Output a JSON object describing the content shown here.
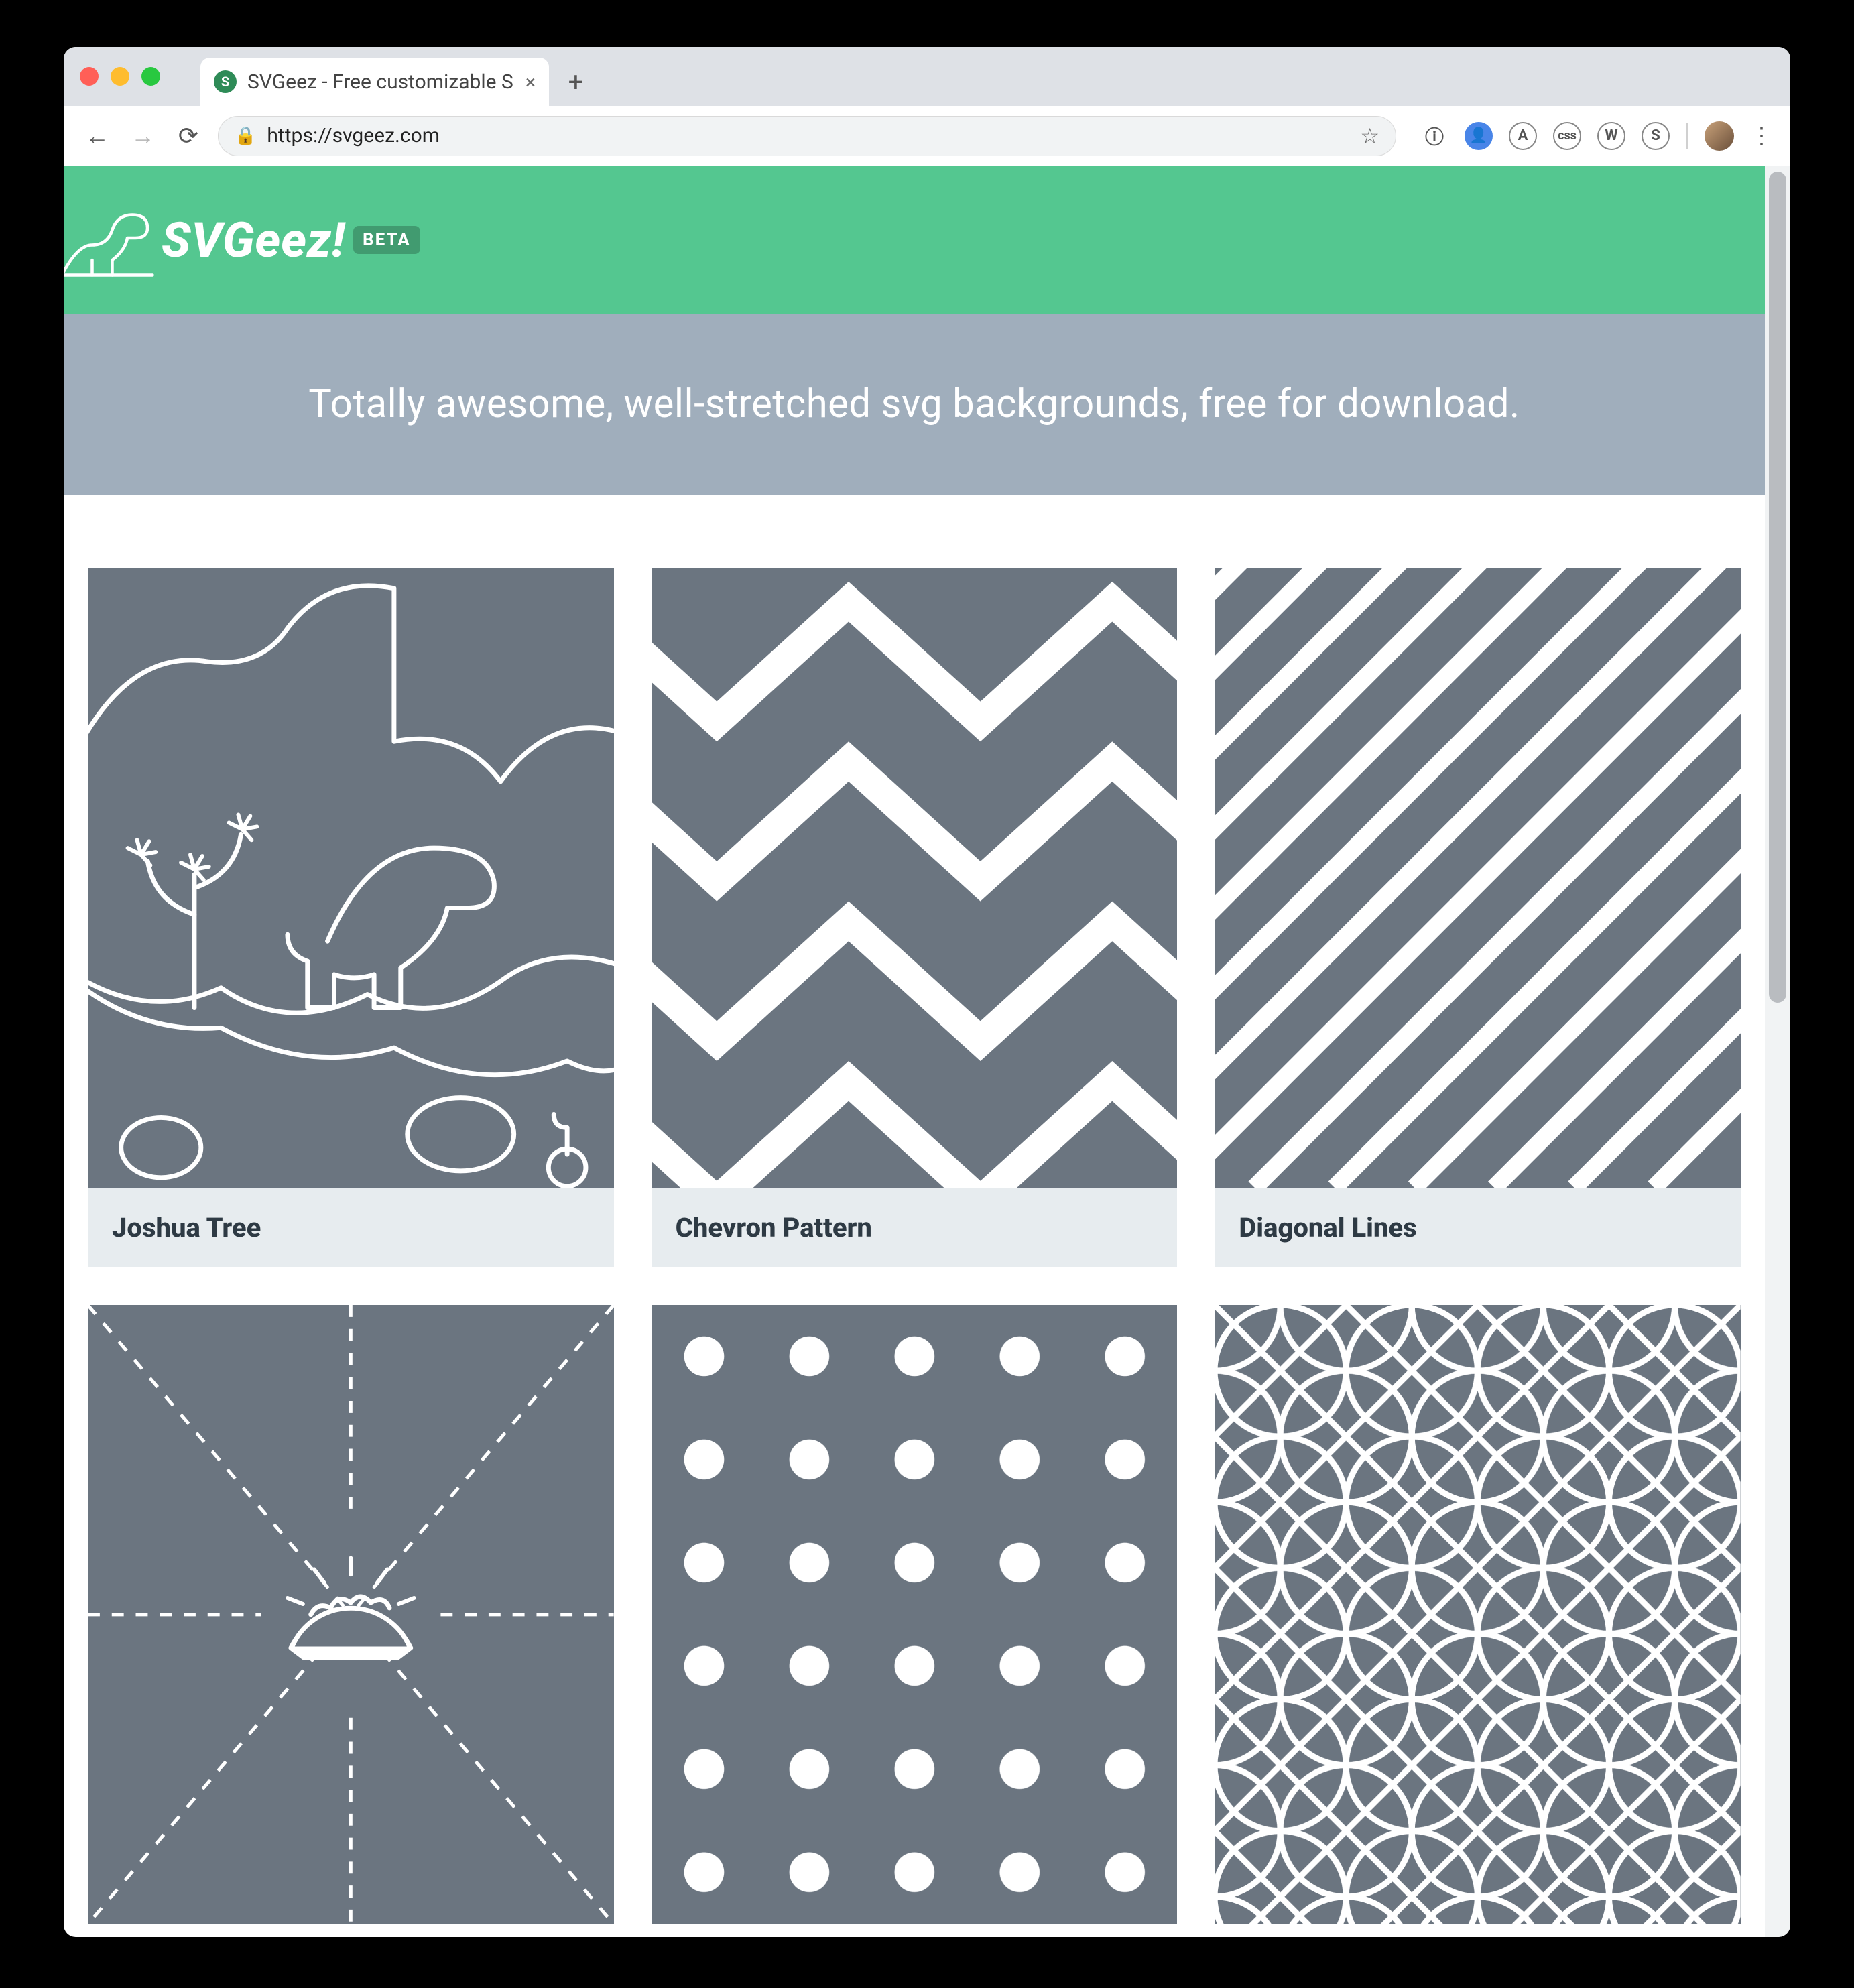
{
  "browser": {
    "tab_title": "SVGeez - Free customizable S",
    "url_display": "https://svgeez.com",
    "toolbar_icons": [
      "i",
      "person",
      "A",
      "css",
      "W",
      "S"
    ]
  },
  "header": {
    "brand": "SVGeez!",
    "badge": "BETA"
  },
  "banner": {
    "tagline": "Totally awesome, well-stretched svg backgrounds, free for download."
  },
  "cards": [
    {
      "title": "Joshua Tree"
    },
    {
      "title": "Chevron Pattern"
    },
    {
      "title": "Diagonal Lines"
    },
    {
      "title": ""
    },
    {
      "title": ""
    },
    {
      "title": ""
    }
  ],
  "colors": {
    "accent": "#54c790",
    "slate": "#6b7580",
    "banner": "#a0aebc"
  }
}
